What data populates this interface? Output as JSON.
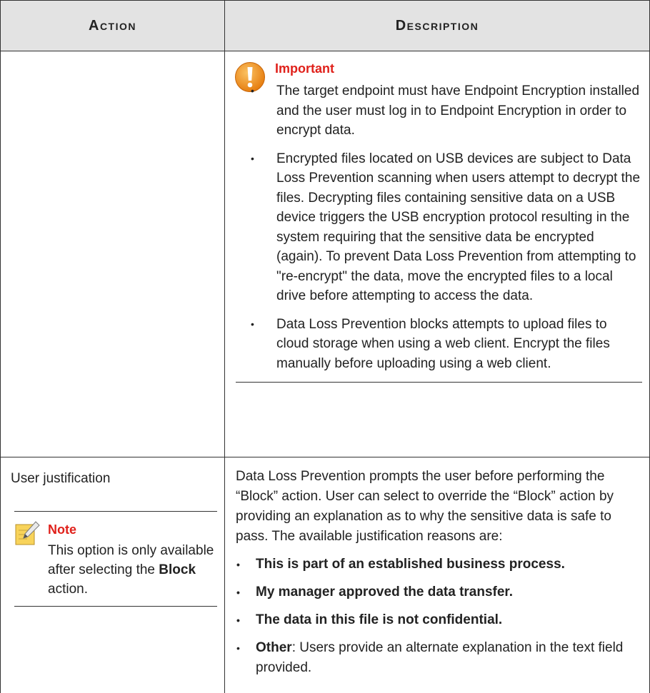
{
  "table": {
    "headers": {
      "action": "Action",
      "description": "Description"
    },
    "row1": {
      "important": {
        "title": "Important",
        "bullets": [
          "The target endpoint must have Endpoint Encryption installed and the user must log in to Endpoint Encryption in order to encrypt data.",
          "Encrypted files located on USB devices are subject to Data Loss Prevention scanning when users attempt to decrypt the files. Decrypting files containing sensitive data on a USB device triggers the USB encryption protocol resulting in the system requiring that the sensitive data be encrypted (again). To prevent Data Loss Prevention from attempting to \"re-encrypt\" the data, move the encrypted files to a local drive before attempting to access the data.",
          "Data Loss Prevention blocks attempts to upload files to cloud storage when using a web client. Encrypt the files manually before uploading using a web client."
        ]
      }
    },
    "row2": {
      "action": "User justification",
      "note": {
        "title": "Note",
        "text_before": "This option is only available after selecting the ",
        "bold": "Block",
        "text_after": " action."
      },
      "description": {
        "intro": "Data Loss Prevention prompts the user before performing the “Block” action. User can select to override the “Block” action by providing an explanation as to why the sensitive data is safe to pass. The available justification reasons are:",
        "reasons": [
          "This is part of an established business process.",
          "My manager approved the data transfer.",
          "The data in this file is not confidential."
        ],
        "other_label": "Other",
        "other_text": ": Users provide an alternate explanation in the text field provided."
      }
    }
  },
  "colors": {
    "header_bg": "#e3e3e3",
    "accent_red": "#e0211b",
    "icon_orange": "#f39c12",
    "note_yellow": "#f5c542"
  },
  "icons": {
    "important": "warning-exclamation-icon",
    "note": "pencil-note-icon"
  }
}
